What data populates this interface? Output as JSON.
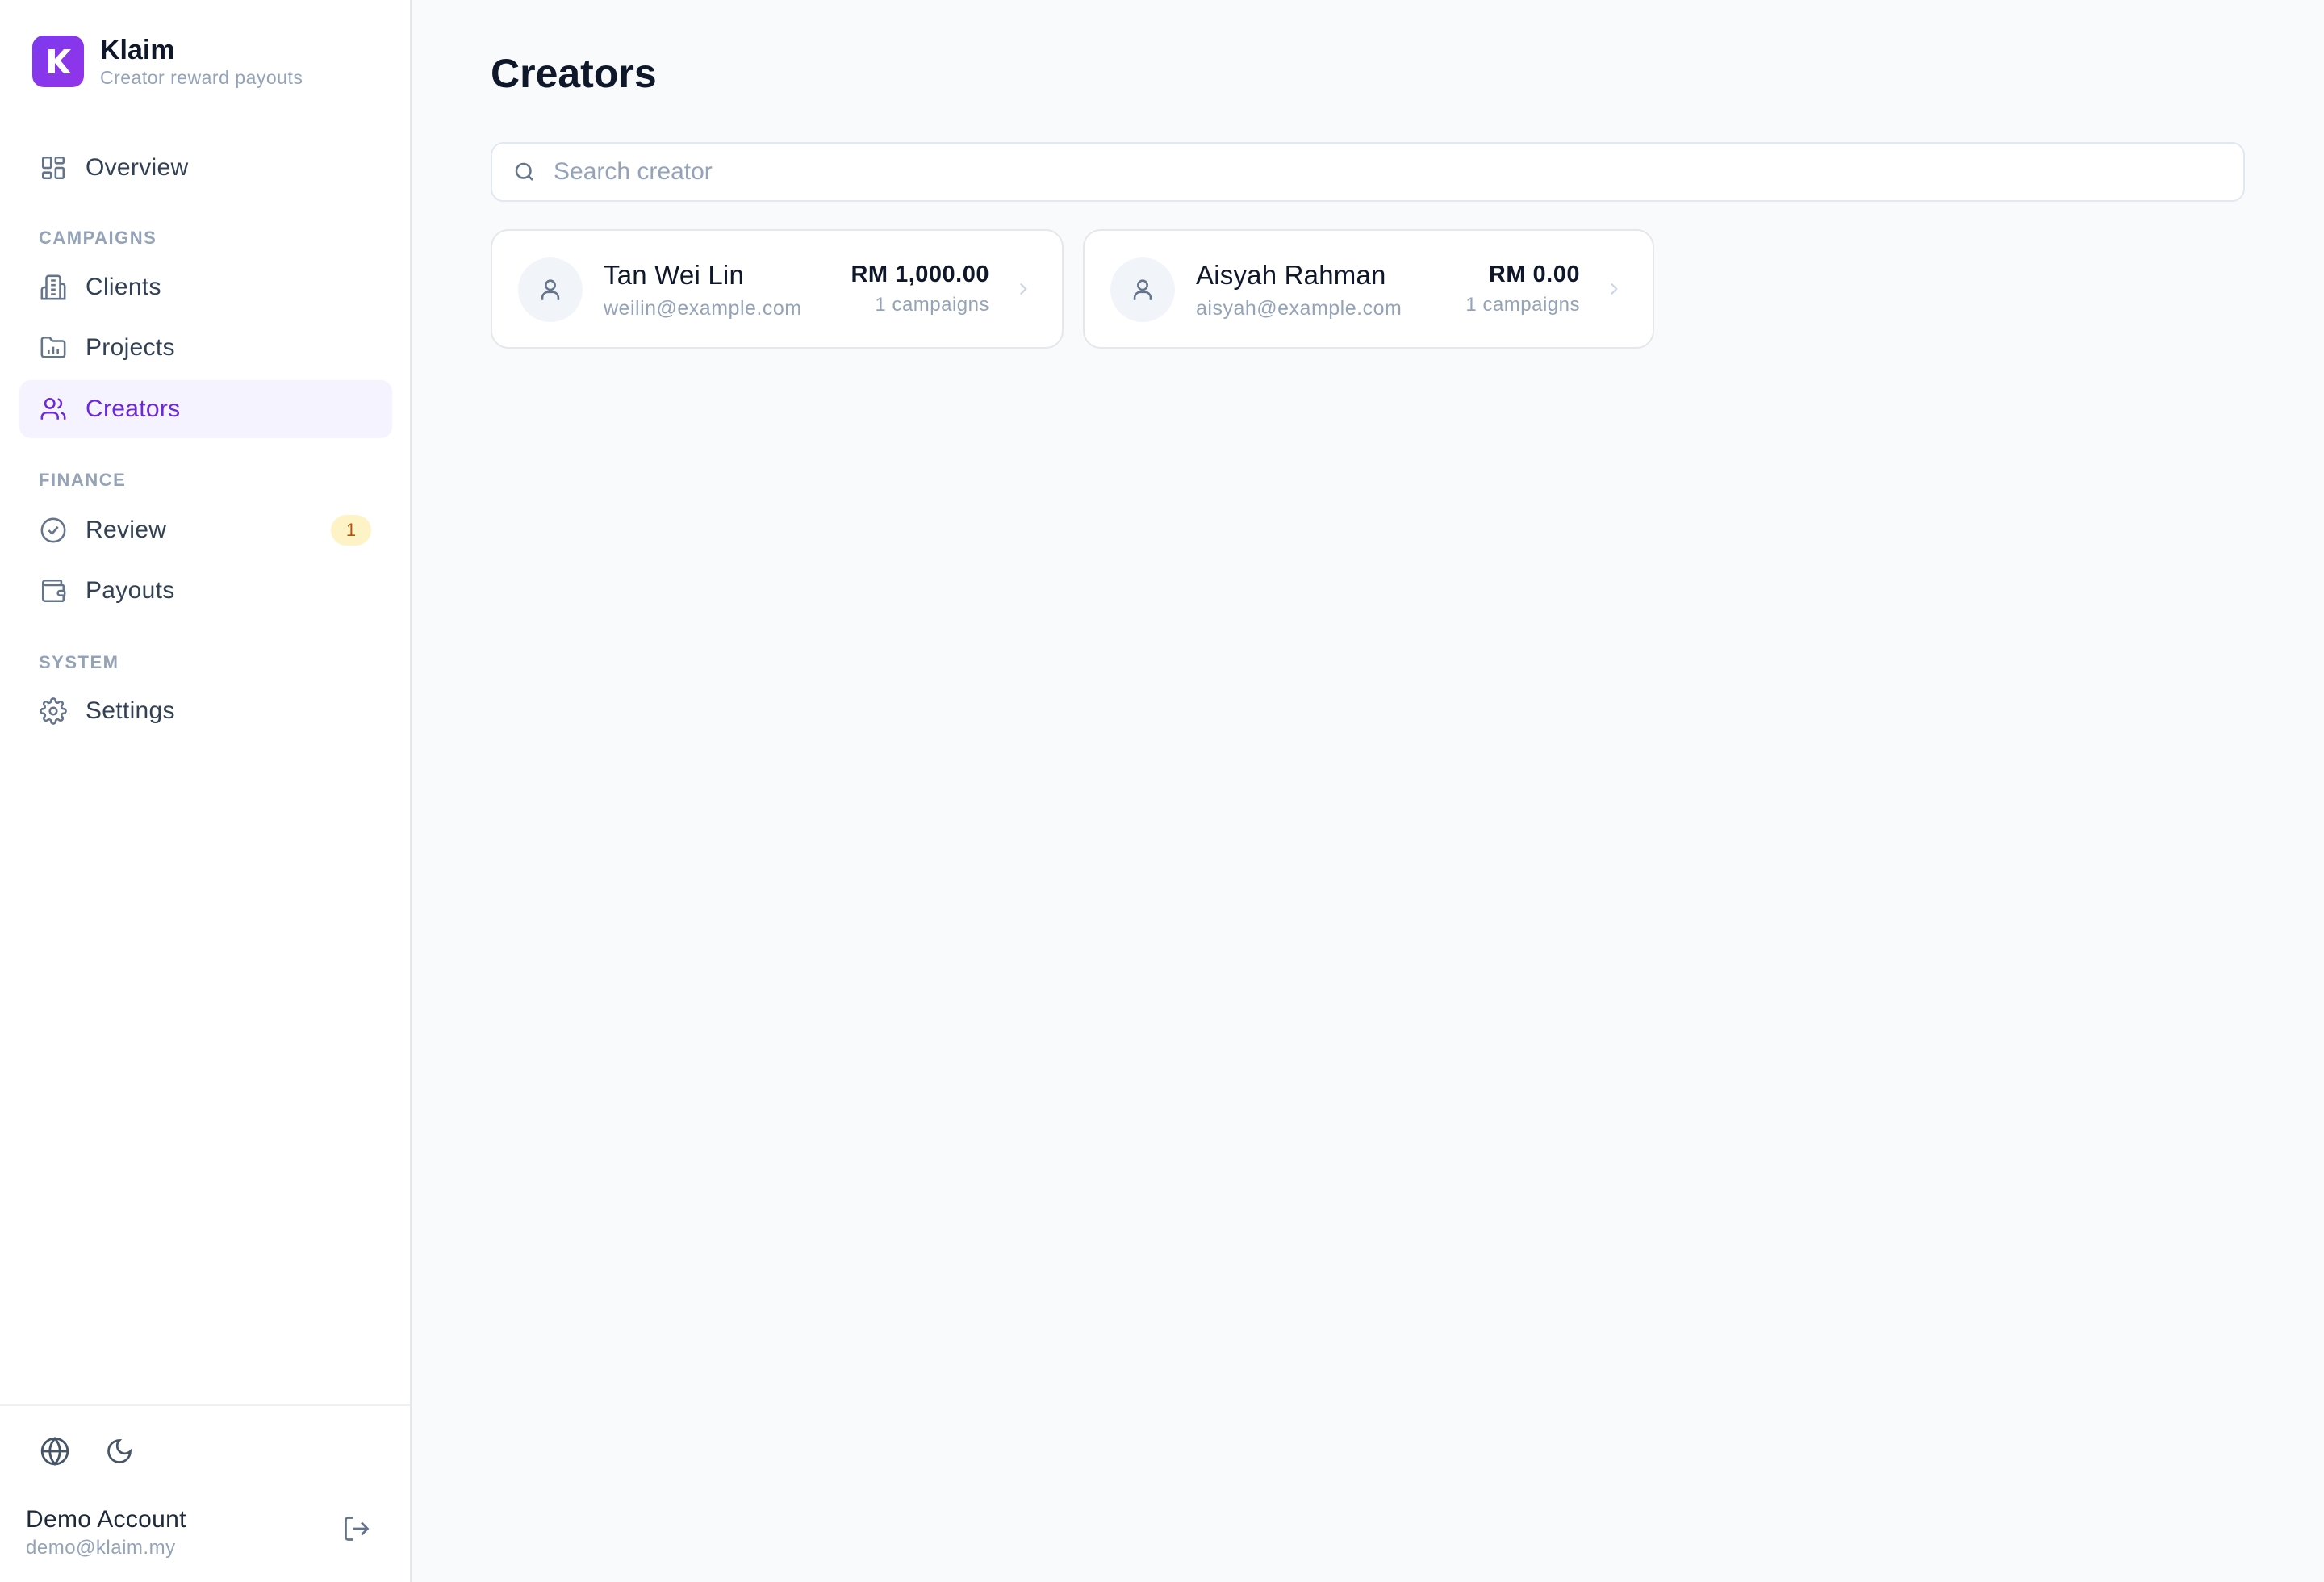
{
  "brand": {
    "name": "Klaim",
    "subtitle": "Creator reward payouts",
    "accent": "#7c3aed"
  },
  "nav": {
    "overview": "Overview",
    "sections": {
      "campaigns": "CAMPAIGNS",
      "finance": "FINANCE",
      "system": "SYSTEM"
    },
    "clients": "Clients",
    "projects": "Projects",
    "creators": "Creators",
    "review": "Review",
    "review_badge": "1",
    "payouts": "Payouts",
    "settings": "Settings",
    "active": "Creators"
  },
  "footer": {
    "icons": [
      "globe-icon",
      "moon-icon",
      "logout-icon"
    ],
    "account_name": "Demo Account",
    "account_email": "demo@klaim.my"
  },
  "page": {
    "title": "Creators",
    "search_placeholder": "Search creator"
  },
  "creators": [
    {
      "name": "Tan Wei Lin",
      "email": "weilin@example.com",
      "amount": "RM 1,000.00",
      "campaigns": "1 campaigns"
    },
    {
      "name": "Aisyah Rahman",
      "email": "aisyah@example.com",
      "amount": "RM 0.00",
      "campaigns": "1 campaigns"
    }
  ]
}
